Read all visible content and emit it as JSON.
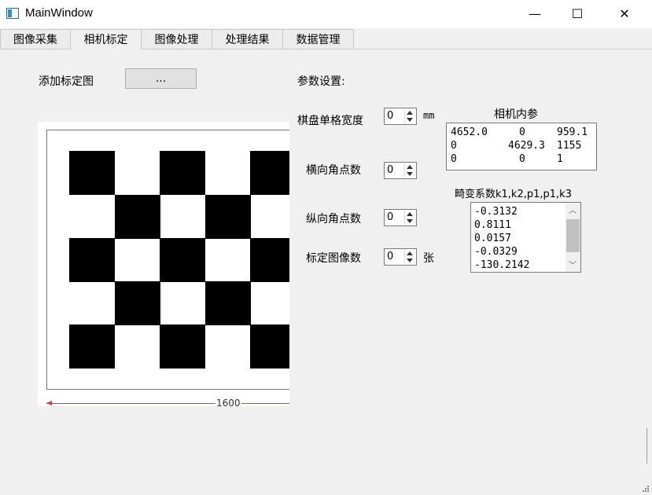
{
  "window": {
    "title": "MainWindow",
    "minimize": "—",
    "maximize": "☐",
    "close": "✕"
  },
  "tabs": [
    {
      "label": "图像采集"
    },
    {
      "label": "相机标定"
    },
    {
      "label": "图像处理"
    },
    {
      "label": "处理结果"
    },
    {
      "label": "数据管理"
    }
  ],
  "calibration": {
    "add_image_label": "添加标定图",
    "browse_button": "...",
    "params_title": "参数设置:",
    "square_width_label": "棋盘单格宽度",
    "square_width_value": "0",
    "square_width_unit": "mm",
    "h_corners_label": "横向角点数",
    "h_corners_value": "0",
    "v_corners_label": "纵向角点数",
    "v_corners_value": "0",
    "image_count_label": "标定图像数",
    "image_count_value": "0",
    "image_count_unit": "张",
    "preview_dimension": "1600"
  },
  "intrinsics": {
    "title": "相机内参",
    "rows": [
      [
        "4652.0",
        "0",
        "959.1"
      ],
      [
        "0",
        "4629.3",
        "1155"
      ],
      [
        "0",
        "0",
        "1"
      ]
    ]
  },
  "distortion": {
    "title": "畸变系数k1,k2,p1,p1,k3",
    "values": [
      "-0.3132",
      "0.8111",
      "0.0157",
      "-0.0329",
      "-130.2142"
    ]
  },
  "colors": {
    "titlebar": "#ffffff",
    "background": "#f0f0f0",
    "dimension_line": "#e03a3a"
  }
}
